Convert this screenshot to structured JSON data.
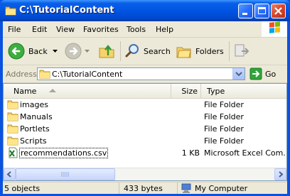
{
  "window": {
    "title": "C:\\TutorialContent",
    "icon": "folder-icon"
  },
  "menubar": {
    "items": [
      "File",
      "Edit",
      "View",
      "Favorites",
      "Tools",
      "Help"
    ]
  },
  "toolbar": {
    "back_label": "Back",
    "search_label": "Search",
    "folders_label": "Folders"
  },
  "address": {
    "label": "Address",
    "value": "C:\\TutorialContent",
    "go_label": "Go"
  },
  "filelist": {
    "columns": {
      "name": "Name",
      "size": "Size",
      "type": "Type"
    },
    "rows": [
      {
        "name": "images",
        "size": "",
        "type": "File Folder",
        "icon": "folder-icon"
      },
      {
        "name": "Manuals",
        "size": "",
        "type": "File Folder",
        "icon": "folder-icon"
      },
      {
        "name": "Portlets",
        "size": "",
        "type": "File Folder",
        "icon": "folder-icon"
      },
      {
        "name": "Scripts",
        "size": "",
        "type": "File Folder",
        "icon": "folder-icon"
      },
      {
        "name": "recommendations.csv",
        "size": "1 KB",
        "type": "Microsoft Excel Com...",
        "icon": "excel-csv-icon"
      }
    ]
  },
  "statusbar": {
    "objects": "5 objects",
    "bytes": "433 bytes",
    "location": "My Computer"
  },
  "colors": {
    "titlebar": "#0054e3",
    "face": "#ece9d8",
    "close": "#d6462a",
    "go_arrow": "#2fa43a"
  }
}
